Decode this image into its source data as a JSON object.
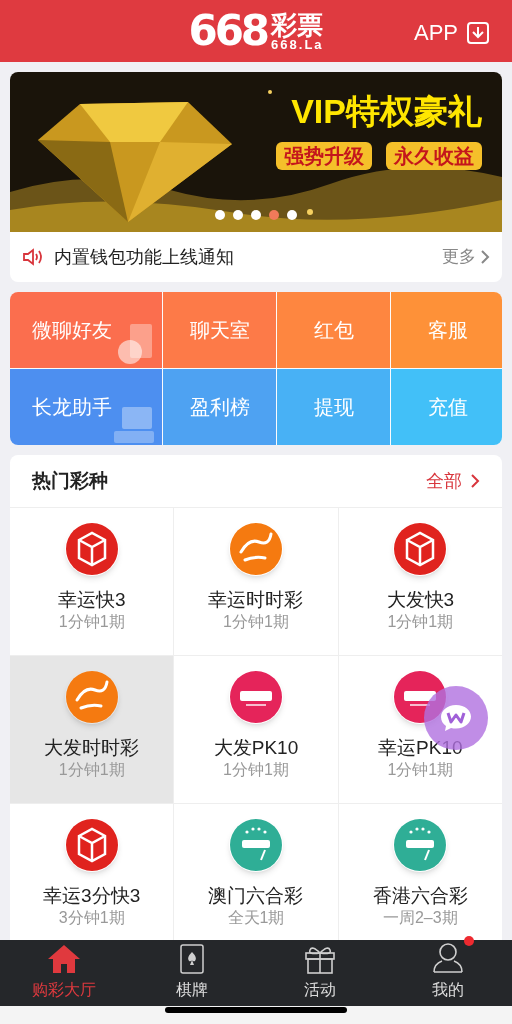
{
  "header": {
    "logo_number": "668",
    "logo_title": "彩票",
    "logo_domain": "668.La",
    "app_label": "APP"
  },
  "banner": {
    "headline": "VIP特权豪礼",
    "tags": [
      "强势升级",
      "永久收益"
    ],
    "dots": [
      {
        "selected": false
      },
      {
        "selected": false
      },
      {
        "selected": false
      },
      {
        "selected": true
      },
      {
        "selected": false
      }
    ]
  },
  "notice": {
    "text": "内置钱包功能上线通知",
    "more": "更多"
  },
  "shortcuts": [
    {
      "label": "微聊好友"
    },
    {
      "label": "聊天室"
    },
    {
      "label": "红包"
    },
    {
      "label": "客服"
    },
    {
      "label": "长龙助手"
    },
    {
      "label": "盈利榜"
    },
    {
      "label": "提现"
    },
    {
      "label": "充值"
    }
  ],
  "hot": {
    "title": "热门彩种",
    "all": "全部",
    "games": [
      {
        "name": "幸运快3",
        "period": "1分钟1期",
        "kind": "k3",
        "selected": false
      },
      {
        "name": "幸运时时彩",
        "period": "1分钟1期",
        "kind": "ssc",
        "selected": false
      },
      {
        "name": "大发快3",
        "period": "1分钟1期",
        "kind": "k3",
        "selected": false
      },
      {
        "name": "大发时时彩",
        "period": "1分钟1期",
        "kind": "ssc",
        "selected": true
      },
      {
        "name": "大发PK10",
        "period": "1分钟1期",
        "kind": "pk10",
        "selected": false
      },
      {
        "name": "幸运PK10",
        "period": "1分钟1期",
        "kind": "pk10",
        "selected": false
      },
      {
        "name": "幸运3分快3",
        "period": "3分钟1期",
        "kind": "k3",
        "selected": false
      },
      {
        "name": "澳门六合彩",
        "period": "全天1期",
        "kind": "lhc",
        "selected": false
      },
      {
        "name": "香港六合彩",
        "period": "一周2–3期",
        "kind": "lhc",
        "selected": false
      }
    ]
  },
  "tabbar": [
    {
      "label": "购彩大厅",
      "selected": true,
      "badge": false
    },
    {
      "label": "棋牌",
      "selected": false,
      "badge": false
    },
    {
      "label": "活动",
      "selected": false,
      "badge": false
    },
    {
      "label": "我的",
      "selected": false,
      "badge": true
    }
  ]
}
